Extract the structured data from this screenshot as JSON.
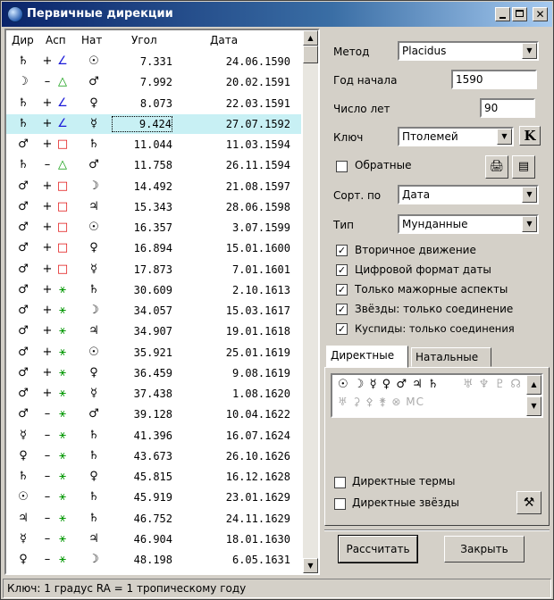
{
  "window": {
    "title": "Первичные дирекции"
  },
  "list": {
    "headers": {
      "dir": "Дир",
      "asp": "Асп",
      "nat": "Нат",
      "angle": "Угол",
      "date": "Дата"
    },
    "rows": [
      {
        "dir": "♄",
        "sign": "+",
        "asp": "∠",
        "asp_color": "blue",
        "nat": "☉",
        "angle": "7.331",
        "date": "24.06.1590"
      },
      {
        "dir": "☽",
        "sign": "–",
        "asp": "△",
        "asp_color": "green",
        "nat": "♂",
        "angle": "7.992",
        "date": "20.02.1591"
      },
      {
        "dir": "♄",
        "sign": "+",
        "asp": "∠",
        "asp_color": "blue",
        "nat": "♀",
        "angle": "8.073",
        "date": "22.03.1591"
      },
      {
        "dir": "♄",
        "sign": "+",
        "asp": "∠",
        "asp_color": "blue",
        "nat": "☿",
        "angle": "9.424",
        "date": "27.07.1592",
        "selected": true
      },
      {
        "dir": "♂",
        "sign": "+",
        "asp": "□",
        "asp_color": "red",
        "nat": "♄",
        "angle": "11.044",
        "date": "11.03.1594"
      },
      {
        "dir": "♄",
        "sign": "–",
        "asp": "△",
        "asp_color": "green",
        "nat": "♂",
        "angle": "11.758",
        "date": "26.11.1594"
      },
      {
        "dir": "♂",
        "sign": "+",
        "asp": "□",
        "asp_color": "red",
        "nat": "☽",
        "angle": "14.492",
        "date": "21.08.1597"
      },
      {
        "dir": "♂",
        "sign": "+",
        "asp": "□",
        "asp_color": "red",
        "nat": "♃",
        "angle": "15.343",
        "date": "28.06.1598"
      },
      {
        "dir": "♂",
        "sign": "+",
        "asp": "□",
        "asp_color": "red",
        "nat": "☉",
        "angle": "16.357",
        "date": "3.07.1599"
      },
      {
        "dir": "♂",
        "sign": "+",
        "asp": "□",
        "asp_color": "red",
        "nat": "♀",
        "angle": "16.894",
        "date": "15.01.1600"
      },
      {
        "dir": "♂",
        "sign": "+",
        "asp": "□",
        "asp_color": "red",
        "nat": "☿",
        "angle": "17.873",
        "date": "7.01.1601"
      },
      {
        "dir": "♂",
        "sign": "+",
        "asp": "⚹",
        "asp_color": "green",
        "nat": "♄",
        "angle": "30.609",
        "date": "2.10.1613"
      },
      {
        "dir": "♂",
        "sign": "+",
        "asp": "⚹",
        "asp_color": "green",
        "nat": "☽",
        "angle": "34.057",
        "date": "15.03.1617"
      },
      {
        "dir": "♂",
        "sign": "+",
        "asp": "⚹",
        "asp_color": "green",
        "nat": "♃",
        "angle": "34.907",
        "date": "19.01.1618"
      },
      {
        "dir": "♂",
        "sign": "+",
        "asp": "⚹",
        "asp_color": "green",
        "nat": "☉",
        "angle": "35.921",
        "date": "25.01.1619"
      },
      {
        "dir": "♂",
        "sign": "+",
        "asp": "⚹",
        "asp_color": "green",
        "nat": "♀",
        "angle": "36.459",
        "date": "9.08.1619"
      },
      {
        "dir": "♂",
        "sign": "+",
        "asp": "⚹",
        "asp_color": "green",
        "nat": "☿",
        "angle": "37.438",
        "date": "1.08.1620"
      },
      {
        "dir": "♂",
        "sign": "–",
        "asp": "⚹",
        "asp_color": "green",
        "nat": "♂",
        "angle": "39.128",
        "date": "10.04.1622"
      },
      {
        "dir": "☿",
        "sign": "–",
        "asp": "⚹",
        "asp_color": "green",
        "nat": "♄",
        "angle": "41.396",
        "date": "16.07.1624"
      },
      {
        "dir": "♀",
        "sign": "–",
        "asp": "⚹",
        "asp_color": "green",
        "nat": "♄",
        "angle": "43.673",
        "date": "26.10.1626"
      },
      {
        "dir": "♄",
        "sign": "–",
        "asp": "⚹",
        "asp_color": "green",
        "nat": "♀",
        "angle": "45.815",
        "date": "16.12.1628"
      },
      {
        "dir": "☉",
        "sign": "–",
        "asp": "⚹",
        "asp_color": "green",
        "nat": "♄",
        "angle": "45.919",
        "date": "23.01.1629"
      },
      {
        "dir": "♃",
        "sign": "–",
        "asp": "⚹",
        "asp_color": "green",
        "nat": "♄",
        "angle": "46.752",
        "date": "24.11.1629"
      },
      {
        "dir": "☿",
        "sign": "–",
        "asp": "⚹",
        "asp_color": "green",
        "nat": "♃",
        "angle": "46.904",
        "date": "18.01.1630"
      },
      {
        "dir": "♀",
        "sign": "–",
        "asp": "⚹",
        "asp_color": "green",
        "nat": "☽",
        "angle": "48.198",
        "date": "6.05.1631"
      }
    ]
  },
  "settings": {
    "method_label": "Метод",
    "method_value": "Placidus",
    "start_year_label": "Год начала",
    "start_year_value": "1590",
    "num_years_label": "Число лет",
    "num_years_value": "90",
    "key_label": "Ключ",
    "key_value": "Птолемей",
    "key_button": "K",
    "reverse_label": "Обратные",
    "sort_label": "Сорт. по",
    "sort_value": "Дата",
    "type_label": "Тип",
    "type_value": "Мунданные",
    "options": [
      {
        "label": "Вторичное движение",
        "checked": true
      },
      {
        "label": "Цифровой формат даты",
        "checked": true
      },
      {
        "label": "Только мажорные аспекты",
        "checked": true
      },
      {
        "label": "Звёзды: только соединение",
        "checked": true
      },
      {
        "label": "Куспиды: только соединения",
        "checked": true
      }
    ]
  },
  "tabs": [
    {
      "label": "Директные",
      "active": true
    },
    {
      "label": "Натальные",
      "active": false
    }
  ],
  "planets": {
    "row1_active": "☉ ☽ ☿ ♀ ♂ ♃ ♄",
    "row1_dim": "♅ ♆ ♇ ☊",
    "row2_dim": "♅ ⚳ ⚴ ⚵ ⊗ MC"
  },
  "direct_terms_label": "Директные термы",
  "direct_stars_label": "Директные звёзды",
  "buttons": {
    "calculate": "Рассчитать",
    "close": "Закрыть"
  },
  "status": "Ключ: 1 градус RA = 1 тропическому году"
}
